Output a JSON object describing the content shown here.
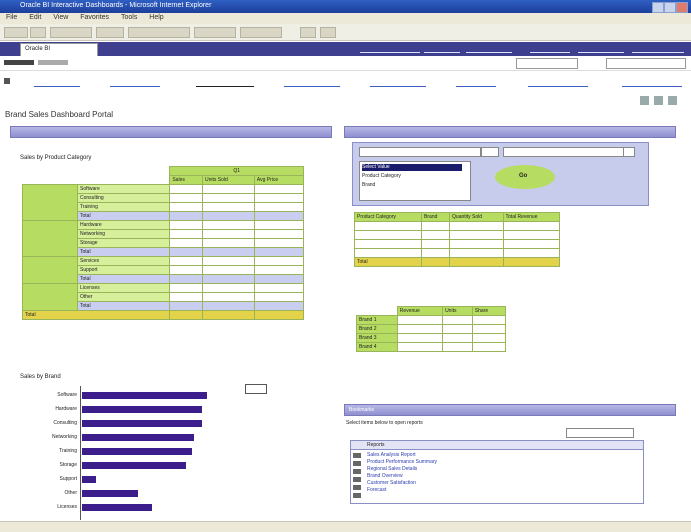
{
  "window": {
    "title": "Oracle BI Interactive Dashboards - Microsoft Internet Explorer"
  },
  "menu": {
    "items": [
      "File",
      "Edit",
      "View",
      "Favorites",
      "Tools",
      "Help"
    ]
  },
  "dashboard": {
    "title": "Oracle BI",
    "page_title": "Brand Sales Dashboard Portal"
  },
  "sales_table": {
    "title": "Sales by Product Category",
    "header_group": "Q1",
    "columns": [
      "Sales",
      "Units Sold",
      "Avg Price"
    ],
    "rows": [
      [
        "",
        "Software",
        "",
        "",
        ""
      ],
      [
        "",
        "Consulting",
        "",
        "",
        ""
      ],
      [
        "",
        "Training",
        "",
        "",
        ""
      ],
      [
        "",
        "Total",
        "",
        "",
        ""
      ],
      [
        "",
        "Hardware",
        "",
        "",
        ""
      ],
      [
        "",
        "Networking",
        "",
        "",
        ""
      ],
      [
        "",
        "Storage",
        "",
        "",
        ""
      ],
      [
        "",
        "Total",
        "",
        "",
        ""
      ],
      [
        "",
        "Services",
        "",
        "",
        ""
      ],
      [
        "",
        "Support",
        "",
        "",
        ""
      ],
      [
        "",
        "Total",
        "",
        "",
        ""
      ],
      [
        "",
        "Licenses",
        "",
        "",
        ""
      ],
      [
        "",
        "Other",
        "",
        "",
        ""
      ],
      [
        "",
        "Total",
        "",
        "",
        ""
      ]
    ],
    "grand_total_label": "Total"
  },
  "bar_chart": {
    "title": "Sales by Brand",
    "labels": [
      "Software",
      "Hardware",
      "Consulting",
      "Networking",
      "Training",
      "Storage",
      "Support",
      "Other",
      "Licenses"
    ]
  },
  "region_table": {
    "columns": [
      "Product Category",
      "Brand",
      "Quantity Sold",
      "Total Revenue"
    ],
    "total_label": "Total"
  },
  "small_table": {
    "columns": [
      "Revenue",
      "Units",
      "Share"
    ],
    "rows": [
      "Brand 1",
      "Brand 2",
      "Brand 3",
      "Brand 4"
    ]
  },
  "filter": {
    "button": "Go",
    "list_items": [
      "Select Value",
      "Product Category",
      "Brand"
    ]
  },
  "bottom_panel": {
    "title": "Bookmarks",
    "desc": "Select items below to open reports",
    "list_header": "Reports",
    "links": [
      "Sales Analysis Report",
      "Product Performance Summary",
      "Regional Sales Details",
      "Brand Overview",
      "Customer Satisfaction",
      "Forecast"
    ]
  }
}
